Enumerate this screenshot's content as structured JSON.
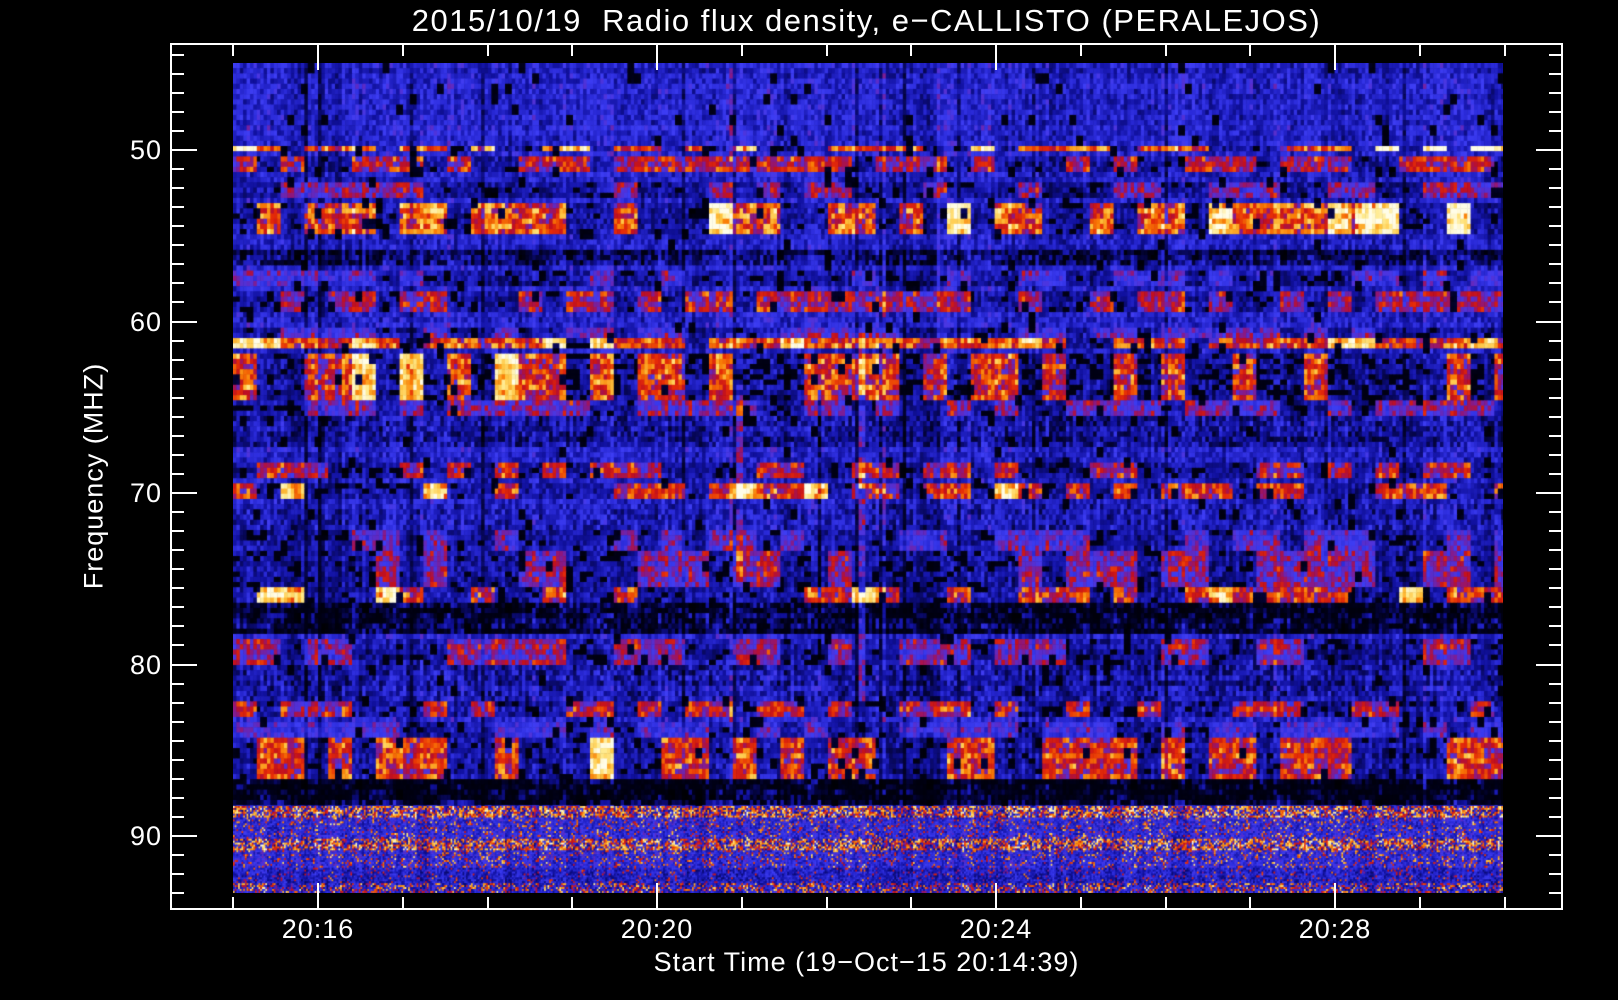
{
  "page": {
    "background": "#000000",
    "text_color": "#ffffff"
  },
  "chart_data": {
    "type": "heatmap",
    "subtype": "radio-spectrogram",
    "title": "2015/10/19  Radio flux density, e−CALLISTO (PERALEJOS)",
    "date": "2015/10/19",
    "quantity": "Radio flux density",
    "instrument": "e-CALLISTO",
    "station": "PERALEJOS",
    "xlabel": "Start Time (19−Oct−15 20:14:39)",
    "ylabel": "Frequency (MHZ)",
    "start_time": "19-Oct-15 20:14:39",
    "x_axis": {
      "tick_labels": [
        "20:16",
        "20:20",
        "20:24",
        "20:28"
      ],
      "major_tick_minutes_after_2016": [
        0,
        4,
        8,
        12
      ],
      "minor_tick_interval_minutes": 1,
      "minor_tick_minutes_range": [
        -1,
        14
      ]
    },
    "y_axis": {
      "tick_labels": [
        "50",
        "60",
        "70",
        "80",
        "90"
      ],
      "tick_values_mhz": [
        50,
        60,
        70,
        80,
        90
      ],
      "minor_divisions_per_major": 9,
      "range_mhz": [
        44.9,
        93.3
      ],
      "inverted": true
    },
    "legend": "none",
    "grid": "off",
    "colormap_stops": [
      [
        0.0,
        "#000004"
      ],
      [
        0.13,
        "#04043a"
      ],
      [
        0.25,
        "#11119e"
      ],
      [
        0.38,
        "#2a2ad8"
      ],
      [
        0.5,
        "#3e3ef4"
      ],
      [
        0.6,
        "#5c2cc8"
      ],
      [
        0.68,
        "#8e187e"
      ],
      [
        0.76,
        "#c11020"
      ],
      [
        0.86,
        "#e62c08"
      ],
      [
        0.97,
        "#fa7d06"
      ],
      [
        1.1,
        "#ffc33e"
      ],
      [
        1.22,
        "#ffea8c"
      ],
      [
        1.35,
        "#fffde8"
      ]
    ],
    "rfi_bands_mhz": [
      {
        "f1": 49.7,
        "f2": 50.2,
        "s": 0.55,
        "style": "blocky",
        "hot": true,
        "hotRight": true
      },
      {
        "f1": 50.3,
        "f2": 51.2,
        "s": 0.38,
        "style": "blocky"
      },
      {
        "f1": 52.0,
        "f2": 52.9,
        "s": 0.3,
        "style": "blocky"
      },
      {
        "f1": 53.2,
        "f2": 54.8,
        "s": 0.55,
        "style": "blocky",
        "hot": true,
        "hotRight": true
      },
      {
        "f1": 55.8,
        "f2": 56.7,
        "s": -0.18,
        "style": "dark"
      },
      {
        "f1": 56.9,
        "f2": 58.0,
        "s": 0.18,
        "style": "blocky"
      },
      {
        "f1": 58.3,
        "f2": 59.5,
        "s": 0.36,
        "style": "blocky"
      },
      {
        "f1": 60.3,
        "f2": 61.0,
        "s": 0.2,
        "style": "blocky"
      },
      {
        "f1": 61.1,
        "f2": 61.6,
        "s": 0.5,
        "style": "blocky",
        "hot": true,
        "pOn": 0.8
      },
      {
        "f1": 61.8,
        "f2": 64.5,
        "s": 0.48,
        "style": "blocky",
        "hot": true,
        "pOn": 0.5,
        "offBlack": 0.28
      },
      {
        "f1": 64.6,
        "f2": 65.5,
        "s": 0.26,
        "style": "blocky"
      },
      {
        "f1": 65.6,
        "f2": 67.4,
        "s": -0.1,
        "style": "dark"
      },
      {
        "f1": 68.3,
        "f2": 69.2,
        "s": 0.4,
        "style": "blocky"
      },
      {
        "f1": 69.3,
        "f2": 70.4,
        "s": 0.44,
        "style": "blocky",
        "hot": true
      },
      {
        "f1": 70.7,
        "f2": 72.2,
        "s": -0.06,
        "style": "dark"
      },
      {
        "f1": 72.3,
        "f2": 73.3,
        "s": 0.2,
        "style": "blocky"
      },
      {
        "f1": 73.4,
        "f2": 75.4,
        "s": 0.3,
        "style": "blocky"
      },
      {
        "f1": 75.4,
        "f2": 76.3,
        "s": 0.46,
        "style": "blocky",
        "hot": true
      },
      {
        "f1": 76.4,
        "f2": 78.1,
        "s": -0.26,
        "style": "dark"
      },
      {
        "f1": 78.6,
        "f2": 79.9,
        "s": 0.3,
        "style": "blocky"
      },
      {
        "f1": 80.0,
        "f2": 82.0,
        "s": -0.08,
        "style": "dark"
      },
      {
        "f1": 82.1,
        "f2": 83.2,
        "s": 0.4,
        "style": "blocky"
      },
      {
        "f1": 83.4,
        "f2": 84.3,
        "s": 0.15,
        "style": "blocky"
      },
      {
        "f1": 84.4,
        "f2": 86.6,
        "s": 0.48,
        "style": "blocky",
        "hot": true
      },
      {
        "f1": 86.7,
        "f2": 88.25,
        "s": -0.3,
        "style": "dark"
      },
      {
        "f1": 88.25,
        "f2": 88.9,
        "s": 0.5,
        "style": "fine-hot"
      },
      {
        "f1": 88.9,
        "f2": 90.2,
        "s": 0.18,
        "style": "fine-mild"
      },
      {
        "f1": 90.2,
        "f2": 90.8,
        "s": 0.42,
        "style": "fine-hot"
      },
      {
        "f1": 90.8,
        "f2": 91.8,
        "s": 0.22,
        "style": "fine-mild"
      },
      {
        "f1": 91.8,
        "f2": 92.7,
        "s": 0.1,
        "style": "fine-quiet"
      },
      {
        "f1": 92.7,
        "f2": 93.3,
        "s": 0.3,
        "style": "fine-speck"
      }
    ],
    "vertical_streaks": [
      {
        "t_min": 6.4,
        "f1": 60.8,
        "f2": 82.1,
        "amp": 0.28
      },
      {
        "t_min": 7.3,
        "f1": 44.9,
        "f2": 61.0,
        "amp": 0.25
      },
      {
        "t_min": 4.95,
        "f1": 63.4,
        "f2": 75.0,
        "amp": 0.25
      },
      {
        "t_min": 5.9,
        "f1": 63.0,
        "f2": 80.0,
        "amp": -0.22
      }
    ],
    "noise": {
      "base": 0.4,
      "cell_jitter": 0.3,
      "col_gain_min": 0.76,
      "col_gain_var": 0.3,
      "dark_col_p": 0.05,
      "bright_col_p": 0.035,
      "black_patch_p": 0.042,
      "seed": 7
    }
  }
}
